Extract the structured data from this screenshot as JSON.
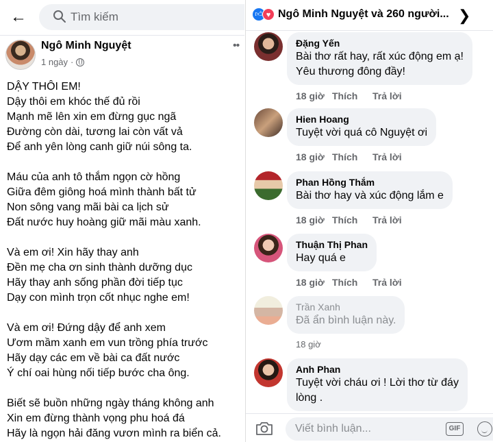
{
  "left": {
    "search_placeholder": "Tìm kiếm",
    "post": {
      "author": "Ngô Minh Nguyệt",
      "time": "1 ngày",
      "more": "••",
      "poem_lines": [
        "DẬY THÔI EM!",
        "Dậy thôi em khóc thế đủ rồi",
        "Mạnh mẽ lên xin em đừng gục ngã",
        "Đường còn dài, tương lai còn vất vả",
        "Để anh yên lòng canh giữ núi sông ta.",
        "",
        "Máu của anh tô thắm ngọn cờ hồng",
        "Giữa đêm giông hoá mình thành bất tử",
        "Non sông vang mãi bài ca lịch sử",
        "Đất nước huy hoàng giữ mãi màu xanh.",
        "",
        "Và em ơi! Xin hãy thay anh",
        "Đền mẹ cha ơn sinh thành dưỡng dục",
        "Hãy thay anh sống phần đời tiếp tục",
        "Dạy con mình trọn cốt nhục nghe em!",
        "",
        "Và em ơi! Đứng dậy để anh xem",
        "Ươm mầm xanh em vun trồng phía trước",
        "Hãy dạy các em về bài ca đất nước",
        "Ý chí oai hùng nối tiếp bước cha ông.",
        "",
        "Biết sẽ buồn những ngày tháng không anh",
        "Xin em đừng thành vọng phu hoá đá",
        "Hãy là ngọn hải đăng vươn mình ra biển cả."
      ]
    }
  },
  "right": {
    "reactions_text": "Ngô Minh Nguyệt và 260 người...",
    "colors": {
      "like": "#1877f2",
      "love": "#f33e58",
      "bubble": "#f0f2f5",
      "meta": "#65676b"
    },
    "comments": [
      {
        "name": "Đặng Yến",
        "text_lines": [
          "Bài thơ rất hay, rất xúc động em ạ!",
          "Yêu thương đông đầy!"
        ],
        "time": "18 giờ",
        "like": "Thích",
        "reply": "Trả lời",
        "hidden": false
      },
      {
        "name": "Hien Hoang",
        "text_lines": [
          "Tuyệt vời quá cô Nguyệt ơi"
        ],
        "time": "18 giờ",
        "like": "Thích",
        "reply": "Trả lời",
        "hidden": false
      },
      {
        "name": "Phan Hồng Thắm",
        "text_lines": [
          "Bài thơ hay và xúc động lắm e"
        ],
        "time": "18 giờ",
        "like": "Thích",
        "reply": "Trả lời",
        "hidden": false
      },
      {
        "name": "Thuận Thị Phan",
        "text_lines": [
          "Hay quá e"
        ],
        "time": "18 giờ",
        "like": "Thích",
        "reply": "Trả lời",
        "hidden": false
      },
      {
        "name": "Trần Xanh",
        "text_lines": [
          "Đã ẩn bình luận này."
        ],
        "time": "18 giờ",
        "like": "",
        "reply": "",
        "hidden": true
      },
      {
        "name": "Anh Phan",
        "text_lines": [
          "Tuyệt vời cháu ơi ! Lời thơ từ đáy",
          "lòng ."
        ],
        "time": "",
        "like": "",
        "reply": "",
        "hidden": false
      }
    ],
    "composer": {
      "placeholder": "Viết bình luận...",
      "gif_label": "GIF"
    }
  }
}
